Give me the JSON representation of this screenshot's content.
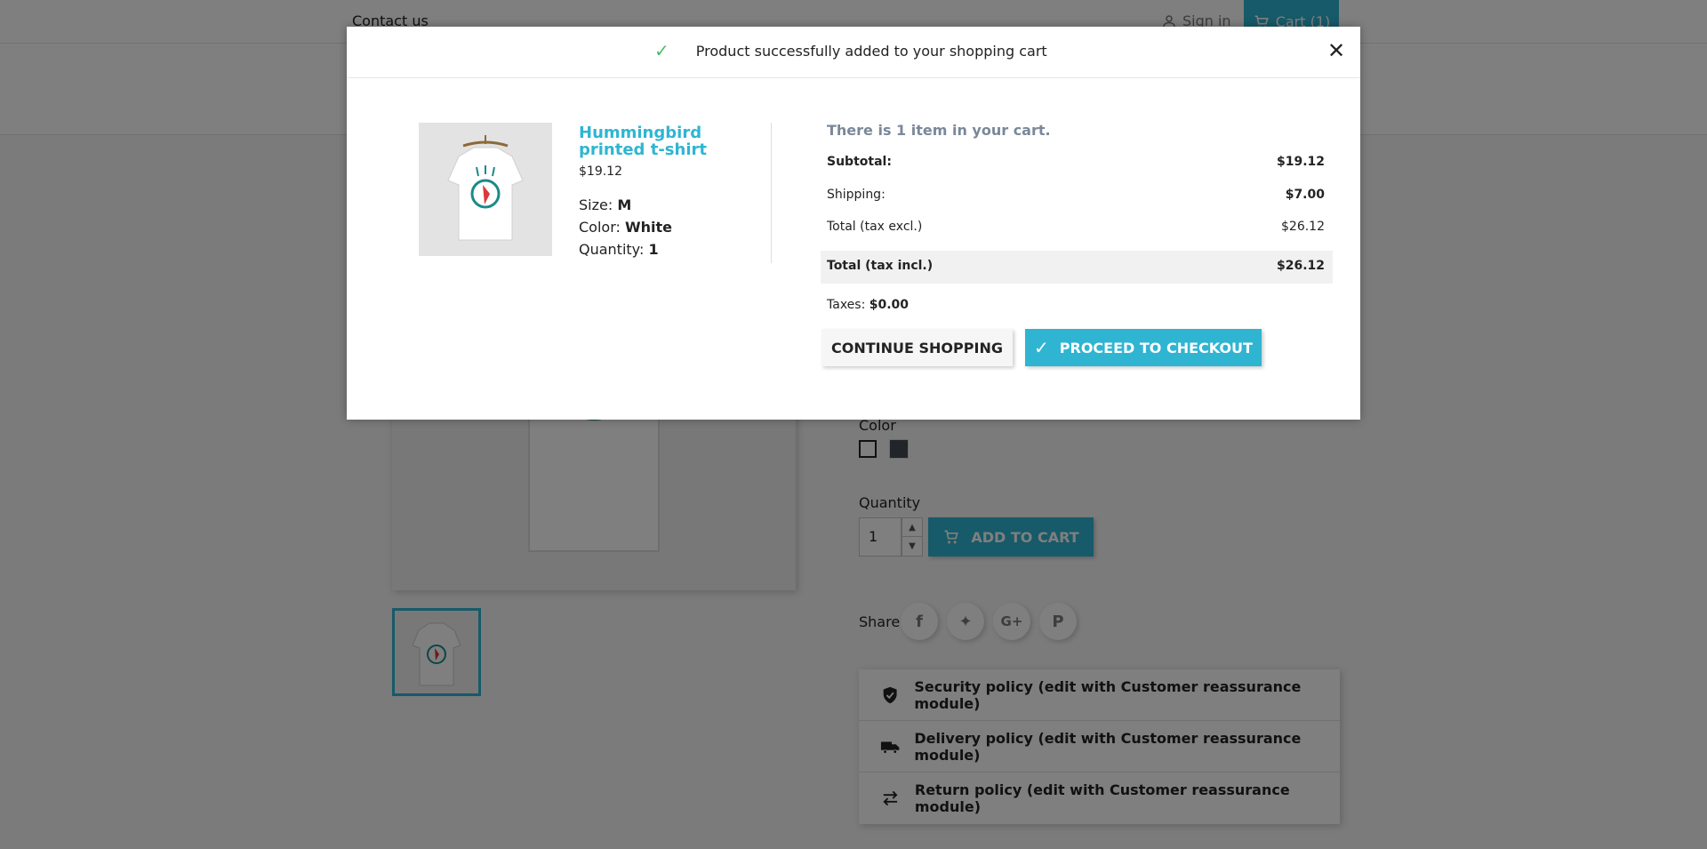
{
  "header": {
    "contact": "Contact us",
    "signin": "Sign in",
    "cart": "Cart (1)"
  },
  "product": {
    "color_label": "Color",
    "quantity_label": "Quantity",
    "quantity_value": "1",
    "add_to_cart": "ADD TO CART",
    "share_label": "Share",
    "swatches": [
      {
        "name": "White",
        "color": "#ffffff"
      },
      {
        "name": "Black",
        "color": "#434a54"
      }
    ],
    "social_icons": [
      "facebook-icon",
      "twitter-icon",
      "google-plus-icon",
      "pinterest-icon"
    ]
  },
  "reassurance": [
    {
      "icon": "shield-check-icon",
      "label": "Security policy (edit with Customer reassurance module)"
    },
    {
      "icon": "truck-icon",
      "label": "Delivery policy (edit with Customer reassurance module)"
    },
    {
      "icon": "swap-arrows-icon",
      "label": "Return policy (edit with Customer reassurance module)"
    }
  ],
  "modal": {
    "title": "Product successfully added to your shopping cart",
    "product_name": "Hummingbird printed t-shirt",
    "product_price": "$19.12",
    "size_label": "Size:",
    "size_value": "M",
    "color_label": "Color:",
    "color_value": "White",
    "quantity_label": "Quantity:",
    "quantity_value": "1",
    "cart_count_text": "There is 1 item in your cart.",
    "subtotal_label": "Subtotal:",
    "subtotal_value": "$19.12",
    "shipping_label": "Shipping:",
    "shipping_value": "$7.00",
    "total_excl_label": "Total (tax excl.)",
    "total_excl_value": "$26.12",
    "total_incl_label": "Total (tax incl.)",
    "total_incl_value": "$26.12",
    "taxes_label": "Taxes:",
    "taxes_value": "$0.00",
    "continue_label": "CONTINUE SHOPPING",
    "checkout_label": "PROCEED TO CHECKOUT"
  },
  "colors": {
    "accent": "#2fb5d2",
    "success": "#4cbb6c"
  }
}
